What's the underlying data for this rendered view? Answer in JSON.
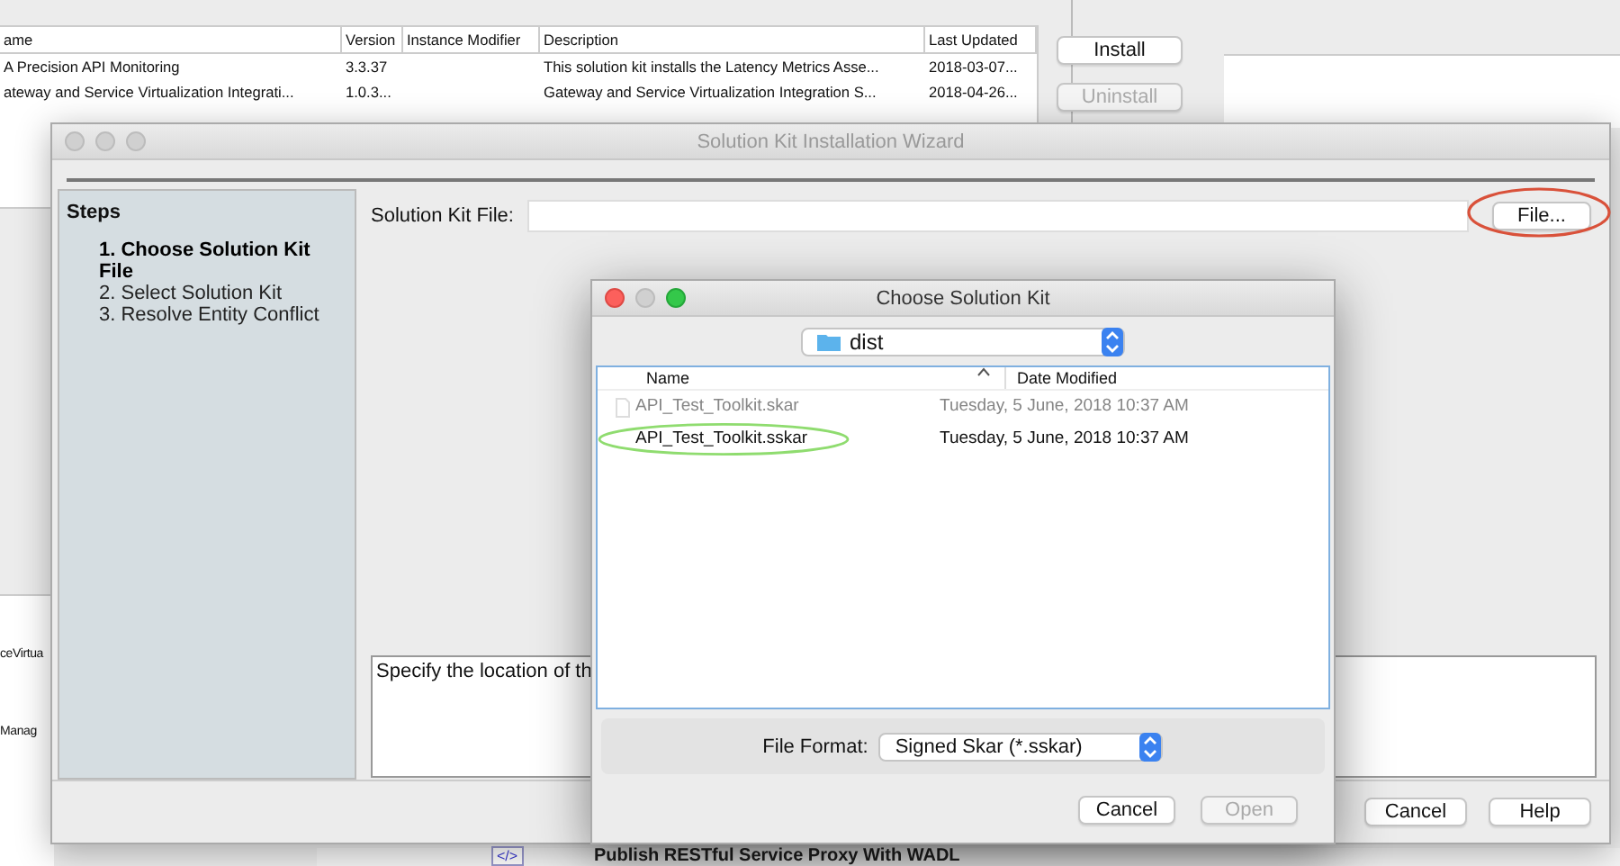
{
  "back_window": {
    "table": {
      "columns": [
        "ame",
        "Version",
        "Instance Modifier",
        "Description",
        "Last Updated"
      ],
      "rows": [
        {
          "cells": [
            "A Precision API Monitoring",
            "3.3.37",
            "",
            "This solution kit installs the Latency Metrics Asse...",
            "2018-03-07..."
          ]
        },
        {
          "cells": [
            "ateway and Service Virtualization Integrati...",
            "1.0.3...",
            "",
            "Gateway and Service Virtualization Integration S...",
            "2018-04-26..."
          ]
        }
      ]
    },
    "buttons": [
      {
        "label": "Install",
        "disabled": false
      },
      {
        "label": "Uninstall",
        "disabled": true
      }
    ],
    "partial_items": [
      "ceVirtua",
      "Manag"
    ]
  },
  "background_item": {
    "icon_text": "</>",
    "title": "Publish RESTful Service Proxy With WADL"
  },
  "wizard": {
    "title": "Solution Kit Installation Wizard",
    "steps_title": "Steps",
    "steps": [
      {
        "label": "1. Choose Solution Kit File",
        "selected": true
      },
      {
        "label": "2. Select Solution Kit",
        "selected": false
      },
      {
        "label": "3. Resolve Entity Conflict",
        "selected": false
      }
    ],
    "file_label": "Solution Kit File:",
    "file_button": "File...",
    "description": "Specify the location of th",
    "buttons": [
      {
        "label": "Cancel",
        "disabled": false
      },
      {
        "label": "Help",
        "disabled": false
      }
    ]
  },
  "dialog": {
    "title": "Choose Solution Kit",
    "folder": "dist",
    "columns": [
      "Name",
      "Date Modified"
    ],
    "files": [
      {
        "name": "API_Test_Toolkit.skar",
        "date": "Tuesday, 5 June, 2018 10:37 AM",
        "disabled": true,
        "circled": false
      },
      {
        "name": "API_Test_Toolkit.sskar",
        "date": "Tuesday, 5 June, 2018 10:37 AM",
        "disabled": false,
        "circled": true
      }
    ],
    "format_label": "File Format:",
    "format_value": "Signed Skar (*.sskar)",
    "buttons": [
      {
        "label": "Cancel",
        "disabled": false
      },
      {
        "label": "Open",
        "disabled": true
      }
    ]
  }
}
